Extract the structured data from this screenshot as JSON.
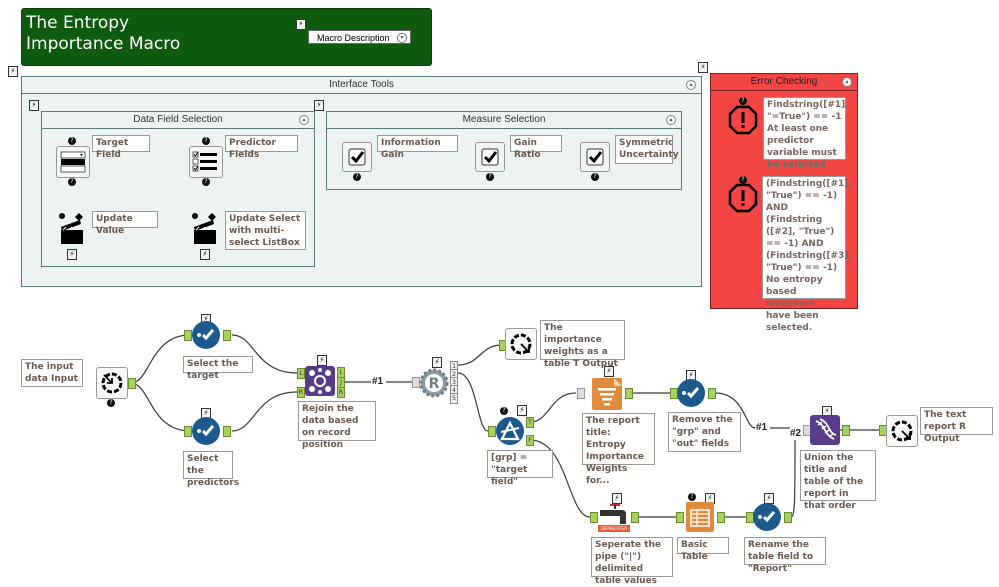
{
  "macro": {
    "title_line1": "The Entropy",
    "title_line2": "Importance Macro",
    "description_button": "Macro Description",
    "title_color": "#0e5a0e"
  },
  "interface_tools": {
    "title": "Interface Tools",
    "data_field_selection": {
      "title": "Data Field Selection",
      "tools": [
        {
          "icon": "dropdown-icon",
          "label": "Target Field"
        },
        {
          "icon": "list-box-icon",
          "label": "Predictor Fields"
        },
        {
          "icon": "action-clapper-icon",
          "label": "Update Value"
        },
        {
          "icon": "action-clapper-icon",
          "label": "Update Select with multi-select ListBox"
        }
      ]
    },
    "measure_selection": {
      "title": "Measure Selection",
      "tools": [
        {
          "icon": "checkbox-icon",
          "label": "Information Gain"
        },
        {
          "icon": "checkbox-icon",
          "label": "Gain Ratio"
        },
        {
          "icon": "checkbox-icon",
          "label": "Symmetric Uncertainty"
        }
      ]
    }
  },
  "error_checking": {
    "title": "Error Checking",
    "color": "#f04040",
    "tools": [
      {
        "icon": "error-message-icon",
        "label": "Findstring([#1], \"=True\") == -1 At least one predictor variable must be selected"
      },
      {
        "icon": "error-message-icon",
        "label": "(Findstring([#1], \"True\") == -1) AND (Findstring ([#2], \"True\") == -1) AND (Findstring([#3], \"True\") == -1) No entropy based measures have been selected."
      }
    ]
  },
  "workflow": {
    "annotations": {
      "input": "The input data Input",
      "select_target": "Select the target",
      "select_predictors": "Select the predictors",
      "join": "Rejoin the data based on record position",
      "importance_output": "The importance weights as a table T Output",
      "filter": "[grp] = \"target field\"",
      "report_title": "The report title: Entropy Importance Weights for...",
      "remove_fields": "Remove the \"grp\" and \"out\" fields",
      "union": "Union the title and table of the report in that order",
      "text_output": "The text report R Output",
      "text_to_columns": "Seperate the pipe (\"|\") delimited table values",
      "basic_table": "Basic Table",
      "rename": "Rename the table field to \"Report\""
    },
    "connection_labels": {
      "join_to_r": "#1",
      "remove_to_union": "#1",
      "union_second": "#2"
    },
    "join_ports": {
      "in": [
        "L",
        "R"
      ],
      "out": [
        "L",
        "J",
        "R"
      ]
    },
    "r_ports": [
      "1",
      "2",
      "3",
      "4",
      "5"
    ],
    "filter_ports": [
      "T",
      "F"
    ],
    "deprecated_badge": "DEPRECATED"
  }
}
